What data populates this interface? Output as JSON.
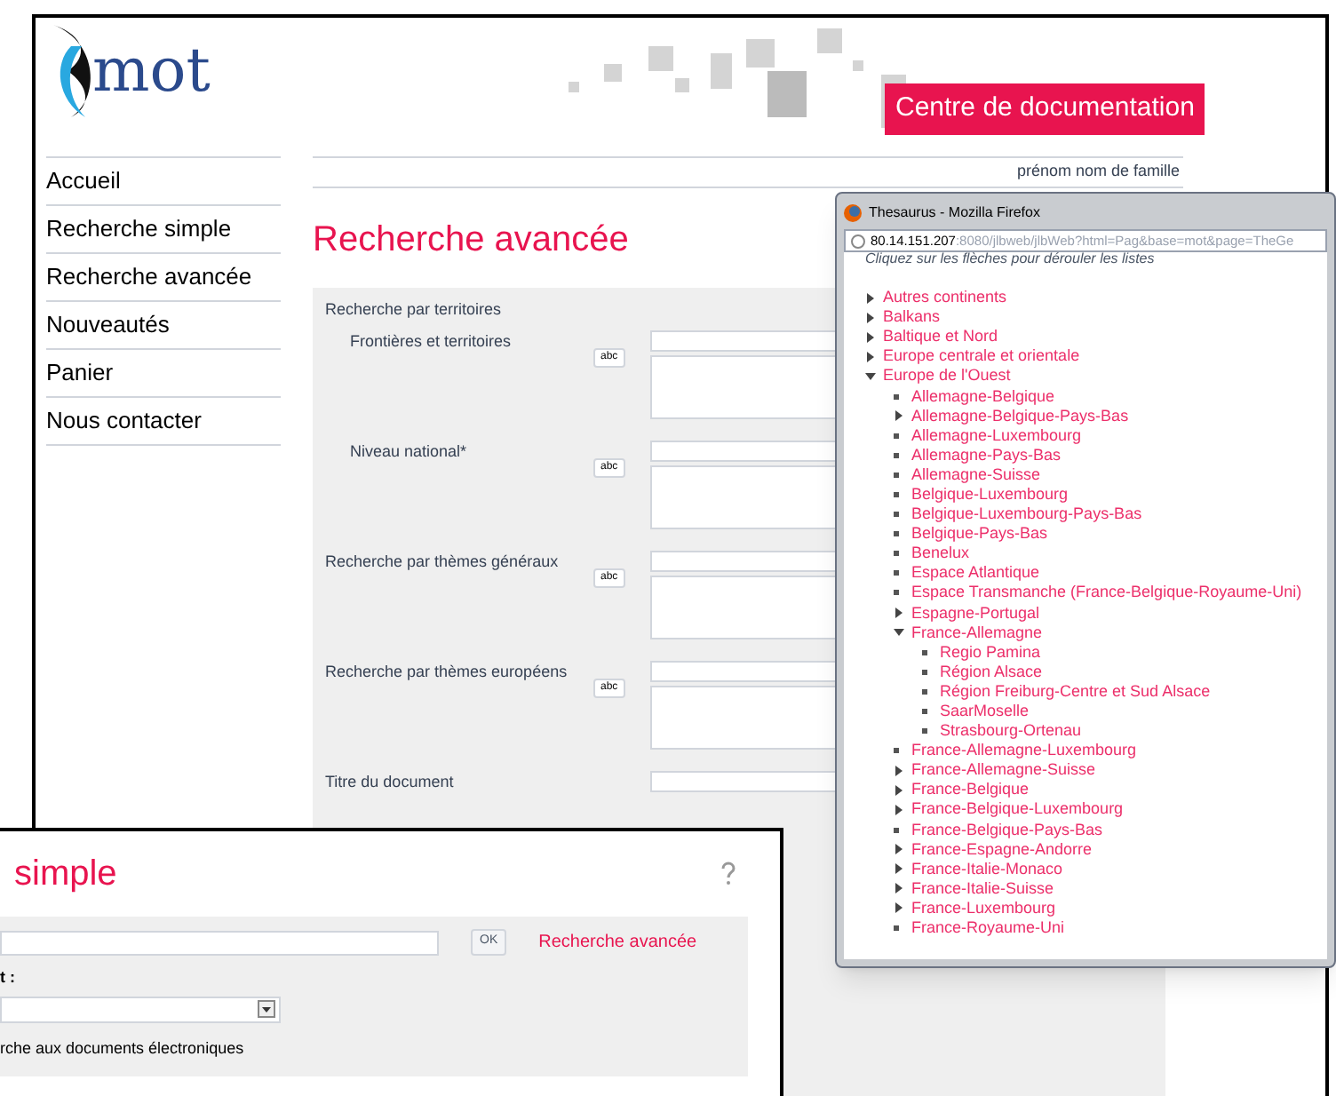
{
  "main_page": {
    "logo": {
      "text": "mot"
    },
    "banner": "Centre de documentation",
    "user_name": "prénom nom de famille",
    "nav": [
      {
        "label": "Accueil"
      },
      {
        "label": "Recherche simple"
      },
      {
        "label": "Recherche avancée"
      },
      {
        "label": "Nouveautés"
      },
      {
        "label": "Panier"
      },
      {
        "label": "Nous contacter"
      }
    ],
    "title": "Recherche avancée",
    "form": [
      {
        "kind": "section",
        "label": "Recherche par territoires"
      },
      {
        "kind": "thesaurus",
        "label": "Frontières et territoires",
        "button": "abc",
        "indented": true
      },
      {
        "kind": "thesaurus",
        "label": "Niveau national*",
        "button": "abc",
        "indented": true
      },
      {
        "kind": "thesaurus",
        "label": "Recherche par thèmes généraux",
        "button": "abc",
        "indented": false
      },
      {
        "kind": "thesaurus",
        "label": "Recherche par thèmes européens",
        "button": "abc",
        "indented": false
      },
      {
        "kind": "text",
        "label": "Titre du document",
        "indented": false
      }
    ]
  },
  "thesaurus_window": {
    "title": "Thesaurus - Mozilla Firefox",
    "url_host": "80.14.151.207",
    "url_rest": ":8080/jlbweb/jlbWeb?html=Pag&base=mot&page=TheGe",
    "hint": "Cliquez sur les flèches pour dérouler les listes",
    "tree": [
      {
        "label": "Autres continents",
        "kind": "branch",
        "expanded": false
      },
      {
        "label": "Balkans",
        "kind": "branch",
        "expanded": false
      },
      {
        "label": "Baltique et Nord",
        "kind": "branch",
        "expanded": false
      },
      {
        "label": "Europe centrale et orientale",
        "kind": "branch",
        "expanded": false
      },
      {
        "label": "Europe de l'Ouest",
        "kind": "branch",
        "expanded": true,
        "children": [
          {
            "label": "Allemagne-Belgique",
            "kind": "leaf"
          },
          {
            "label": "Allemagne-Belgique-Pays-Bas",
            "kind": "branch",
            "expanded": false
          },
          {
            "label": "Allemagne-Luxembourg",
            "kind": "leaf"
          },
          {
            "label": "Allemagne-Pays-Bas",
            "kind": "leaf"
          },
          {
            "label": "Allemagne-Suisse",
            "kind": "leaf"
          },
          {
            "label": "Belgique-Luxembourg",
            "kind": "leaf"
          },
          {
            "label": "Belgique-Luxembourg-Pays-Bas",
            "kind": "leaf"
          },
          {
            "label": "Belgique-Pays-Bas",
            "kind": "leaf"
          },
          {
            "label": "Benelux",
            "kind": "leaf"
          },
          {
            "label": "Espace Atlantique",
            "kind": "leaf"
          },
          {
            "label": "Espace Transmanche (France-Belgique-Royaume-Uni)",
            "kind": "leaf"
          },
          {
            "label": "Espagne-Portugal",
            "kind": "branch",
            "expanded": false
          },
          {
            "label": "France-Allemagne",
            "kind": "branch",
            "expanded": true,
            "children": [
              {
                "label": "Regio Pamina",
                "kind": "leaf"
              },
              {
                "label": "Région Alsace",
                "kind": "leaf"
              },
              {
                "label": "Région Freiburg-Centre et Sud Alsace",
                "kind": "leaf"
              },
              {
                "label": "SaarMoselle",
                "kind": "leaf"
              },
              {
                "label": "Strasbourg-Ortenau",
                "kind": "leaf"
              }
            ]
          },
          {
            "label": "France-Allemagne-Luxembourg",
            "kind": "leaf"
          },
          {
            "label": "France-Allemagne-Suisse",
            "kind": "branch",
            "expanded": false
          },
          {
            "label": "France-Belgique",
            "kind": "branch",
            "expanded": false
          },
          {
            "label": "France-Belgique-Luxembourg",
            "kind": "branch",
            "expanded": false
          },
          {
            "label": "France-Belgique-Pays-Bas",
            "kind": "leaf"
          },
          {
            "label": "France-Espagne-Andorre",
            "kind": "branch",
            "expanded": false
          },
          {
            "label": "France-Italie-Monaco",
            "kind": "branch",
            "expanded": false
          },
          {
            "label": "France-Italie-Suisse",
            "kind": "branch",
            "expanded": false
          },
          {
            "label": "France-Luxembourg",
            "kind": "branch",
            "expanded": false
          },
          {
            "label": "France-Royaume-Uni",
            "kind": "leaf"
          }
        ]
      }
    ]
  },
  "simple_search_window": {
    "title": "simple",
    "search_button": "OK",
    "advanced_link": "Recherche avancée",
    "field_label": "t :",
    "option_text": "rche aux documents électroniques"
  }
}
